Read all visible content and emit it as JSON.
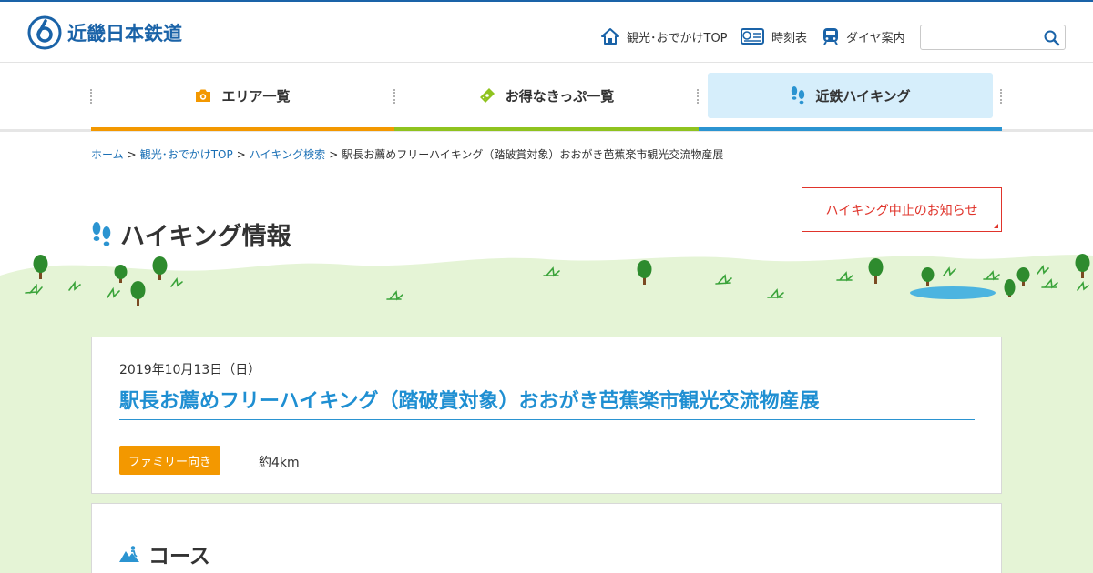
{
  "header": {
    "logo_text": "近畿日本鉄道",
    "utility_links": [
      {
        "label": "観光･おでかけTOP",
        "icon": "home-icon"
      },
      {
        "label": "時刻表",
        "icon": "timetable-icon"
      },
      {
        "label": "ダイヤ案内",
        "icon": "train-icon"
      }
    ],
    "search": {
      "placeholder": "",
      "value": ""
    }
  },
  "nav": {
    "items": [
      {
        "label": "エリア一覧",
        "icon": "camera-icon",
        "accent": "#f39800"
      },
      {
        "label": "お得なきっぷ一覧",
        "icon": "ticket-icon",
        "accent": "#8fc31f"
      },
      {
        "label": "近鉄ハイキング",
        "icon": "footprints-icon",
        "accent": "#2b94d1",
        "active": true
      }
    ]
  },
  "breadcrumb": {
    "items": [
      "ホーム",
      "観光･おでかけTOP",
      "ハイキング検索"
    ],
    "separator": ">",
    "current": "駅長お薦めフリーハイキング（踏破賞対象）おおがき芭蕉楽市観光交流物産展"
  },
  "notice_button": {
    "label": "ハイキング中止のお知らせ",
    "color": "#e0342b"
  },
  "page_title": "ハイキング情報",
  "event": {
    "date": "2019年10月13日（日）",
    "title": "駅長お薦めフリーハイキング（踏破賞対象）おおがき芭蕉楽市観光交流物産展",
    "tag": "ファミリー向き",
    "tag_color": "#f39800",
    "distance": "約4km"
  },
  "course_heading": "コース",
  "colors": {
    "brand": "#1a63a8",
    "title_blue": "#1f8fd2",
    "grass": "#e5f4d6"
  }
}
